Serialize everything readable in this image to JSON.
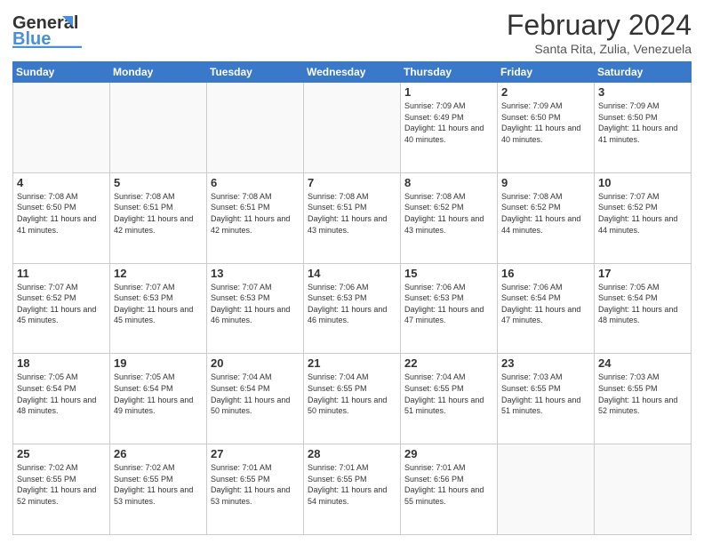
{
  "header": {
    "logo_general": "General",
    "logo_blue": "Blue",
    "title": "February 2024",
    "subtitle": "Santa Rita, Zulia, Venezuela"
  },
  "days_of_week": [
    "Sunday",
    "Monday",
    "Tuesday",
    "Wednesday",
    "Thursday",
    "Friday",
    "Saturday"
  ],
  "weeks": [
    [
      {
        "day": "",
        "info": ""
      },
      {
        "day": "",
        "info": ""
      },
      {
        "day": "",
        "info": ""
      },
      {
        "day": "",
        "info": ""
      },
      {
        "day": "1",
        "info": "Sunrise: 7:09 AM\nSunset: 6:49 PM\nDaylight: 11 hours and 40 minutes."
      },
      {
        "day": "2",
        "info": "Sunrise: 7:09 AM\nSunset: 6:50 PM\nDaylight: 11 hours and 40 minutes."
      },
      {
        "day": "3",
        "info": "Sunrise: 7:09 AM\nSunset: 6:50 PM\nDaylight: 11 hours and 41 minutes."
      }
    ],
    [
      {
        "day": "4",
        "info": "Sunrise: 7:08 AM\nSunset: 6:50 PM\nDaylight: 11 hours and 41 minutes."
      },
      {
        "day": "5",
        "info": "Sunrise: 7:08 AM\nSunset: 6:51 PM\nDaylight: 11 hours and 42 minutes."
      },
      {
        "day": "6",
        "info": "Sunrise: 7:08 AM\nSunset: 6:51 PM\nDaylight: 11 hours and 42 minutes."
      },
      {
        "day": "7",
        "info": "Sunrise: 7:08 AM\nSunset: 6:51 PM\nDaylight: 11 hours and 43 minutes."
      },
      {
        "day": "8",
        "info": "Sunrise: 7:08 AM\nSunset: 6:52 PM\nDaylight: 11 hours and 43 minutes."
      },
      {
        "day": "9",
        "info": "Sunrise: 7:08 AM\nSunset: 6:52 PM\nDaylight: 11 hours and 44 minutes."
      },
      {
        "day": "10",
        "info": "Sunrise: 7:07 AM\nSunset: 6:52 PM\nDaylight: 11 hours and 44 minutes."
      }
    ],
    [
      {
        "day": "11",
        "info": "Sunrise: 7:07 AM\nSunset: 6:52 PM\nDaylight: 11 hours and 45 minutes."
      },
      {
        "day": "12",
        "info": "Sunrise: 7:07 AM\nSunset: 6:53 PM\nDaylight: 11 hours and 45 minutes."
      },
      {
        "day": "13",
        "info": "Sunrise: 7:07 AM\nSunset: 6:53 PM\nDaylight: 11 hours and 46 minutes."
      },
      {
        "day": "14",
        "info": "Sunrise: 7:06 AM\nSunset: 6:53 PM\nDaylight: 11 hours and 46 minutes."
      },
      {
        "day": "15",
        "info": "Sunrise: 7:06 AM\nSunset: 6:53 PM\nDaylight: 11 hours and 47 minutes."
      },
      {
        "day": "16",
        "info": "Sunrise: 7:06 AM\nSunset: 6:54 PM\nDaylight: 11 hours and 47 minutes."
      },
      {
        "day": "17",
        "info": "Sunrise: 7:05 AM\nSunset: 6:54 PM\nDaylight: 11 hours and 48 minutes."
      }
    ],
    [
      {
        "day": "18",
        "info": "Sunrise: 7:05 AM\nSunset: 6:54 PM\nDaylight: 11 hours and 48 minutes."
      },
      {
        "day": "19",
        "info": "Sunrise: 7:05 AM\nSunset: 6:54 PM\nDaylight: 11 hours and 49 minutes."
      },
      {
        "day": "20",
        "info": "Sunrise: 7:04 AM\nSunset: 6:54 PM\nDaylight: 11 hours and 50 minutes."
      },
      {
        "day": "21",
        "info": "Sunrise: 7:04 AM\nSunset: 6:55 PM\nDaylight: 11 hours and 50 minutes."
      },
      {
        "day": "22",
        "info": "Sunrise: 7:04 AM\nSunset: 6:55 PM\nDaylight: 11 hours and 51 minutes."
      },
      {
        "day": "23",
        "info": "Sunrise: 7:03 AM\nSunset: 6:55 PM\nDaylight: 11 hours and 51 minutes."
      },
      {
        "day": "24",
        "info": "Sunrise: 7:03 AM\nSunset: 6:55 PM\nDaylight: 11 hours and 52 minutes."
      }
    ],
    [
      {
        "day": "25",
        "info": "Sunrise: 7:02 AM\nSunset: 6:55 PM\nDaylight: 11 hours and 52 minutes."
      },
      {
        "day": "26",
        "info": "Sunrise: 7:02 AM\nSunset: 6:55 PM\nDaylight: 11 hours and 53 minutes."
      },
      {
        "day": "27",
        "info": "Sunrise: 7:01 AM\nSunset: 6:55 PM\nDaylight: 11 hours and 53 minutes."
      },
      {
        "day": "28",
        "info": "Sunrise: 7:01 AM\nSunset: 6:55 PM\nDaylight: 11 hours and 54 minutes."
      },
      {
        "day": "29",
        "info": "Sunrise: 7:01 AM\nSunset: 6:56 PM\nDaylight: 11 hours and 55 minutes."
      },
      {
        "day": "",
        "info": ""
      },
      {
        "day": "",
        "info": ""
      }
    ]
  ]
}
